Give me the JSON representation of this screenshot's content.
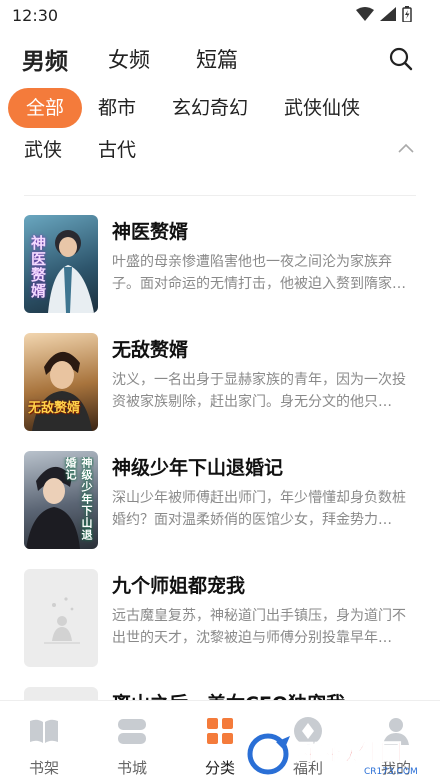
{
  "status": {
    "time": "12:30"
  },
  "top_tabs": [
    "男频",
    "女频",
    "短篇"
  ],
  "categories_row1": [
    "全部",
    "都市",
    "玄幻奇幻",
    "武侠仙侠"
  ],
  "categories_row2": [
    "武侠",
    "古代"
  ],
  "books": [
    {
      "title": "神医赘婿",
      "desc": "叶盛的母亲惨遭陷害他也一夜之间沦为家族弃子。面对命运的无情打击，他被迫入赘到隋家…",
      "cover_text": "神医赘婿",
      "cover_color": "#3a6f8a"
    },
    {
      "title": "无敌赘婿",
      "desc": "沈义，一名出身于显赫家族的青年，因为一次投资被家族剔除，赶出家门。身无分文的他只…",
      "cover_text": "无敌赘婿",
      "cover_color": "#6b4a2e"
    },
    {
      "title": "神级少年下山退婚记",
      "desc": "深山少年被师傅赶出师门，年少懵懂却身负数桩婚约？面对温柔娇俏的医馆少女，拜金势力…",
      "cover_text": "神级少年下山退婚记",
      "cover_color": "#3b4453"
    },
    {
      "title": "九个师姐都宠我",
      "desc": "远古魔皇复苏，神秘道门出手镇压，身为道门不出世的天才，沈黎被迫与师傅分别投靠早年…",
      "cover_text": "",
      "cover_color": "#e9e9e9"
    },
    {
      "title": "离山之后，美女CEO独宠我",
      "desc": "",
      "cover_text": "",
      "cover_color": "#e9e9e9"
    }
  ],
  "bottom_nav": [
    {
      "label": "书架",
      "icon": "book-icon"
    },
    {
      "label": "书城",
      "icon": "store-icon"
    },
    {
      "label": "分类",
      "icon": "category-grid-icon"
    },
    {
      "label": "福利",
      "icon": "gift-icon"
    },
    {
      "label": "我的",
      "icon": "profile-icon"
    }
  ],
  "watermark": {
    "text": "西西软件园",
    "sub": "CR173.COM"
  },
  "colors": {
    "accent": "#f47b3b",
    "muted": "#8a8a8a",
    "nav_inactive": "#c8ccd1"
  }
}
